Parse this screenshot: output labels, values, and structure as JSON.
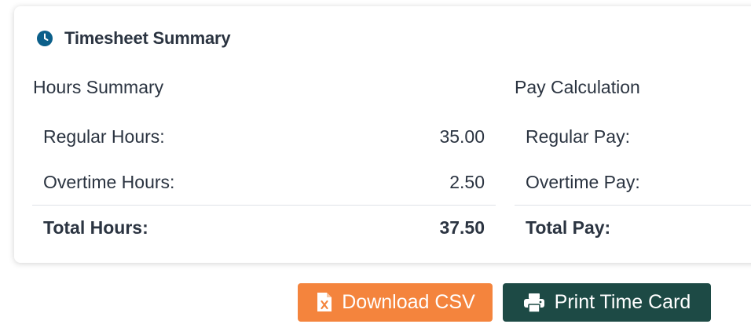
{
  "colors": {
    "accent": "#0b5f8a",
    "csv_button": "#f4843d",
    "print_button": "#1d4a45",
    "text": "#2b3441"
  },
  "summary": {
    "title": "Timesheet Summary",
    "icon": "clock-icon",
    "hours": {
      "title": "Hours Summary",
      "rows": [
        {
          "label": "Regular Hours:",
          "value": "35.00"
        },
        {
          "label": "Overtime Hours:",
          "value": "2.50"
        }
      ],
      "total": {
        "label": "Total Hours:",
        "value": "37.50"
      }
    },
    "pay": {
      "title": "Pay Calculation",
      "rows": [
        {
          "label": "Regular Pay:"
        },
        {
          "label": "Overtime Pay:"
        }
      ],
      "total": {
        "label": "Total Pay:"
      }
    }
  },
  "actions": {
    "download_csv": {
      "label": "Download CSV",
      "icon": "file-excel-icon"
    },
    "print_card": {
      "label": "Print Time Card",
      "icon": "printer-icon"
    }
  }
}
